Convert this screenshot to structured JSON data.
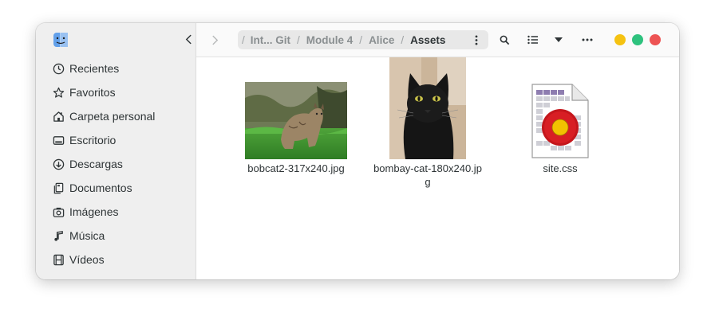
{
  "sidebar": {
    "items": [
      {
        "label": "Recientes",
        "icon": "clock-icon"
      },
      {
        "label": "Favoritos",
        "icon": "star-icon"
      },
      {
        "label": "Carpeta personal",
        "icon": "home-icon"
      },
      {
        "label": "Escritorio",
        "icon": "desktop-icon"
      },
      {
        "label": "Descargas",
        "icon": "download-icon"
      },
      {
        "label": "Documentos",
        "icon": "documents-icon"
      },
      {
        "label": "Imágenes",
        "icon": "camera-icon"
      },
      {
        "label": "Música",
        "icon": "music-icon"
      },
      {
        "label": "Vídeos",
        "icon": "film-icon"
      }
    ]
  },
  "path": {
    "crumbs": [
      "Int... Git",
      "Module 4",
      "Alice",
      "Assets"
    ]
  },
  "files": [
    {
      "name": "bobcat2-317x240.jpg",
      "type": "image-thumbnail"
    },
    {
      "name": "bombay-cat-180x240.jpg",
      "type": "image-thumbnail"
    },
    {
      "name": "site.css",
      "type": "css-file-icon"
    }
  ],
  "window_controls": {
    "minimize_color": "#f5c211",
    "maximize_color": "#2ec27e",
    "close_color": "#ed5353"
  }
}
